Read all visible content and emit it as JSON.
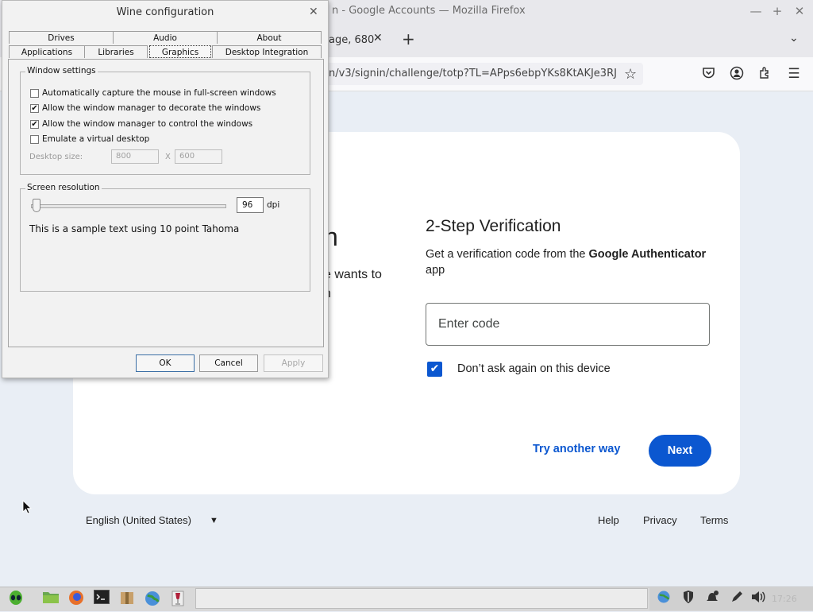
{
  "firefox": {
    "window_title": "n - Google Accounts — Mozilla Firefox",
    "tab_title": "age, 680",
    "url": "n/v3/signin/challenge/totp?TL=APps6ebpYKs8KtAKJe3RJ",
    "winbtn_min": "—",
    "winbtn_max": "+",
    "winbtn_close": "✕",
    "tab_close": "✕",
    "new_tab": "+",
    "tab_list": "⌄"
  },
  "google": {
    "left_heading_partial": "n",
    "left_text_partial_1": "e wants to",
    "left_text_partial_2": "n",
    "heading": "2-Step Verification",
    "desc_prefix": "Get a verification code from the ",
    "desc_app": "Google Authenticator",
    "desc_suffix": " app",
    "code_placeholder": "Enter code",
    "dont_ask_label": "Don’t ask again on this device",
    "dont_ask_checked": true,
    "try_another": "Try another way",
    "next": "Next",
    "footer": {
      "language": "English (United States)",
      "help": "Help",
      "privacy": "Privacy",
      "terms": "Terms"
    },
    "accent_color": "#0b57d0"
  },
  "wine": {
    "title": "Wine configuration",
    "close": "✕",
    "tabs_row1": [
      "Drives",
      "Audio",
      "About"
    ],
    "tabs_row2": [
      "Applications",
      "Libraries",
      "Graphics",
      "Desktop Integration"
    ],
    "active_tab": "Graphics",
    "window_settings": {
      "legend": "Window settings",
      "options": [
        {
          "label": "Automatically capture the mouse in full-screen windows",
          "checked": false
        },
        {
          "label": "Allow the window manager to decorate the windows",
          "checked": true
        },
        {
          "label": "Allow the window manager to control the windows",
          "checked": true
        },
        {
          "label": "Emulate a virtual desktop",
          "checked": false
        }
      ],
      "desktop_size_label": "Desktop size:",
      "width": "800",
      "x_sep": "X",
      "height": "600"
    },
    "screen_resolution": {
      "legend": "Screen resolution",
      "dpi_value": "96",
      "dpi_unit": "dpi",
      "sample_text": "This is a sample text using 10 point Tahoma"
    },
    "buttons": {
      "ok": "OK",
      "cancel": "Cancel",
      "apply": "Apply"
    }
  },
  "taskbar": {
    "clock": "17:26"
  }
}
